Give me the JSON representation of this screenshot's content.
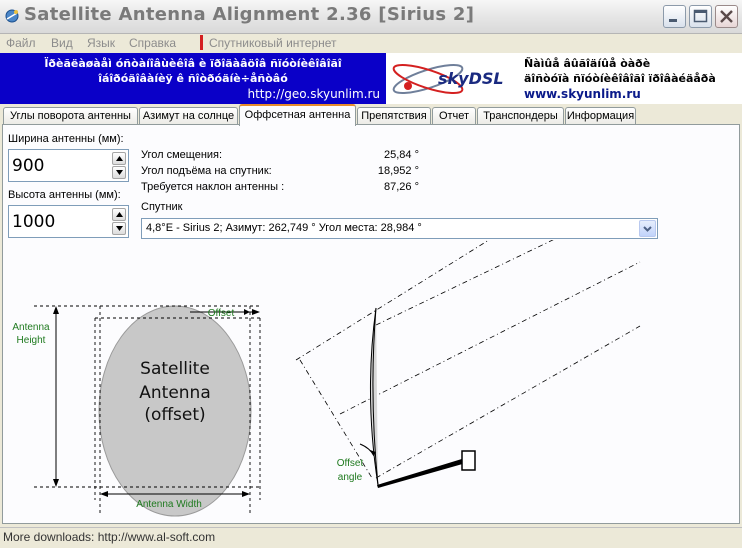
{
  "window": {
    "title": "Satellite Antenna Alignment 2.36 [Sirius 2]"
  },
  "menu": {
    "items": [
      "Файл",
      "Вид",
      "Язык",
      "Справка"
    ],
    "internet": "Спутниковый интернет"
  },
  "banner": {
    "left_line1": "Ïðèãëàøàåì óñòàíîâùèêîâ è ïðîäàâöîâ ñïóòíèêîâîãî",
    "left_line2": "îáîðóäîâàíèÿ ê ñîòðóäíè÷åñòâó",
    "left_url": "http://geo.skyunlim.ru",
    "logo_text": "skyDSL",
    "right_line1": "Ñàìûå âûãîäíûå òàðè",
    "right_line2": "äîñòóïà ñïóòíèêîâîãî ïðîâàéäåðà",
    "right_url": "www.skyunlim.ru"
  },
  "tabs": [
    {
      "label": "Углы поворота антенны",
      "active": false
    },
    {
      "label": "Азимут на солнце",
      "active": false
    },
    {
      "label": "Оффсетная антенна",
      "active": true
    },
    {
      "label": "Препятствия",
      "active": false
    },
    {
      "label": "Отчет",
      "active": false
    },
    {
      "label": "Транспондеры",
      "active": false
    },
    {
      "label": "Информация",
      "active": false
    }
  ],
  "fields": {
    "width_label": "Ширина антенны (мм):",
    "width_value": "900",
    "height_label": "Высота антенны (мм):",
    "height_value": "1000"
  },
  "info": {
    "offset_angle_label": "Угол смещения:",
    "offset_angle_value": "25,84 °",
    "elevation_label": "Угол подъёма на спутник:",
    "elevation_value": "18,952 °",
    "tilt_label": "Требуется наклон антенны :",
    "tilt_value": "87,26 °"
  },
  "satellite": {
    "label": "Спутник",
    "selected": "4,8°E - Sirius 2;  Азимут: 262,749 °  Угол места: 28,984 °"
  },
  "diagram": {
    "dish_line1": "Satellite",
    "dish_line2": "Antenna",
    "dish_line3": "(offset)",
    "offset_label": "Offset",
    "height_label_1": "Antenna",
    "height_label_2": "Height",
    "width_label": "Antenna Width",
    "offset_angle_1": "Offset",
    "offset_angle_2": "angle"
  },
  "status": {
    "text": "More downloads: http://www.al-soft.com"
  },
  "colors": {
    "banner_blue": "#0a00c8",
    "label_green": "#1f7a1f",
    "tab_accent": "#e68b2c",
    "logo_red": "#d42020"
  }
}
